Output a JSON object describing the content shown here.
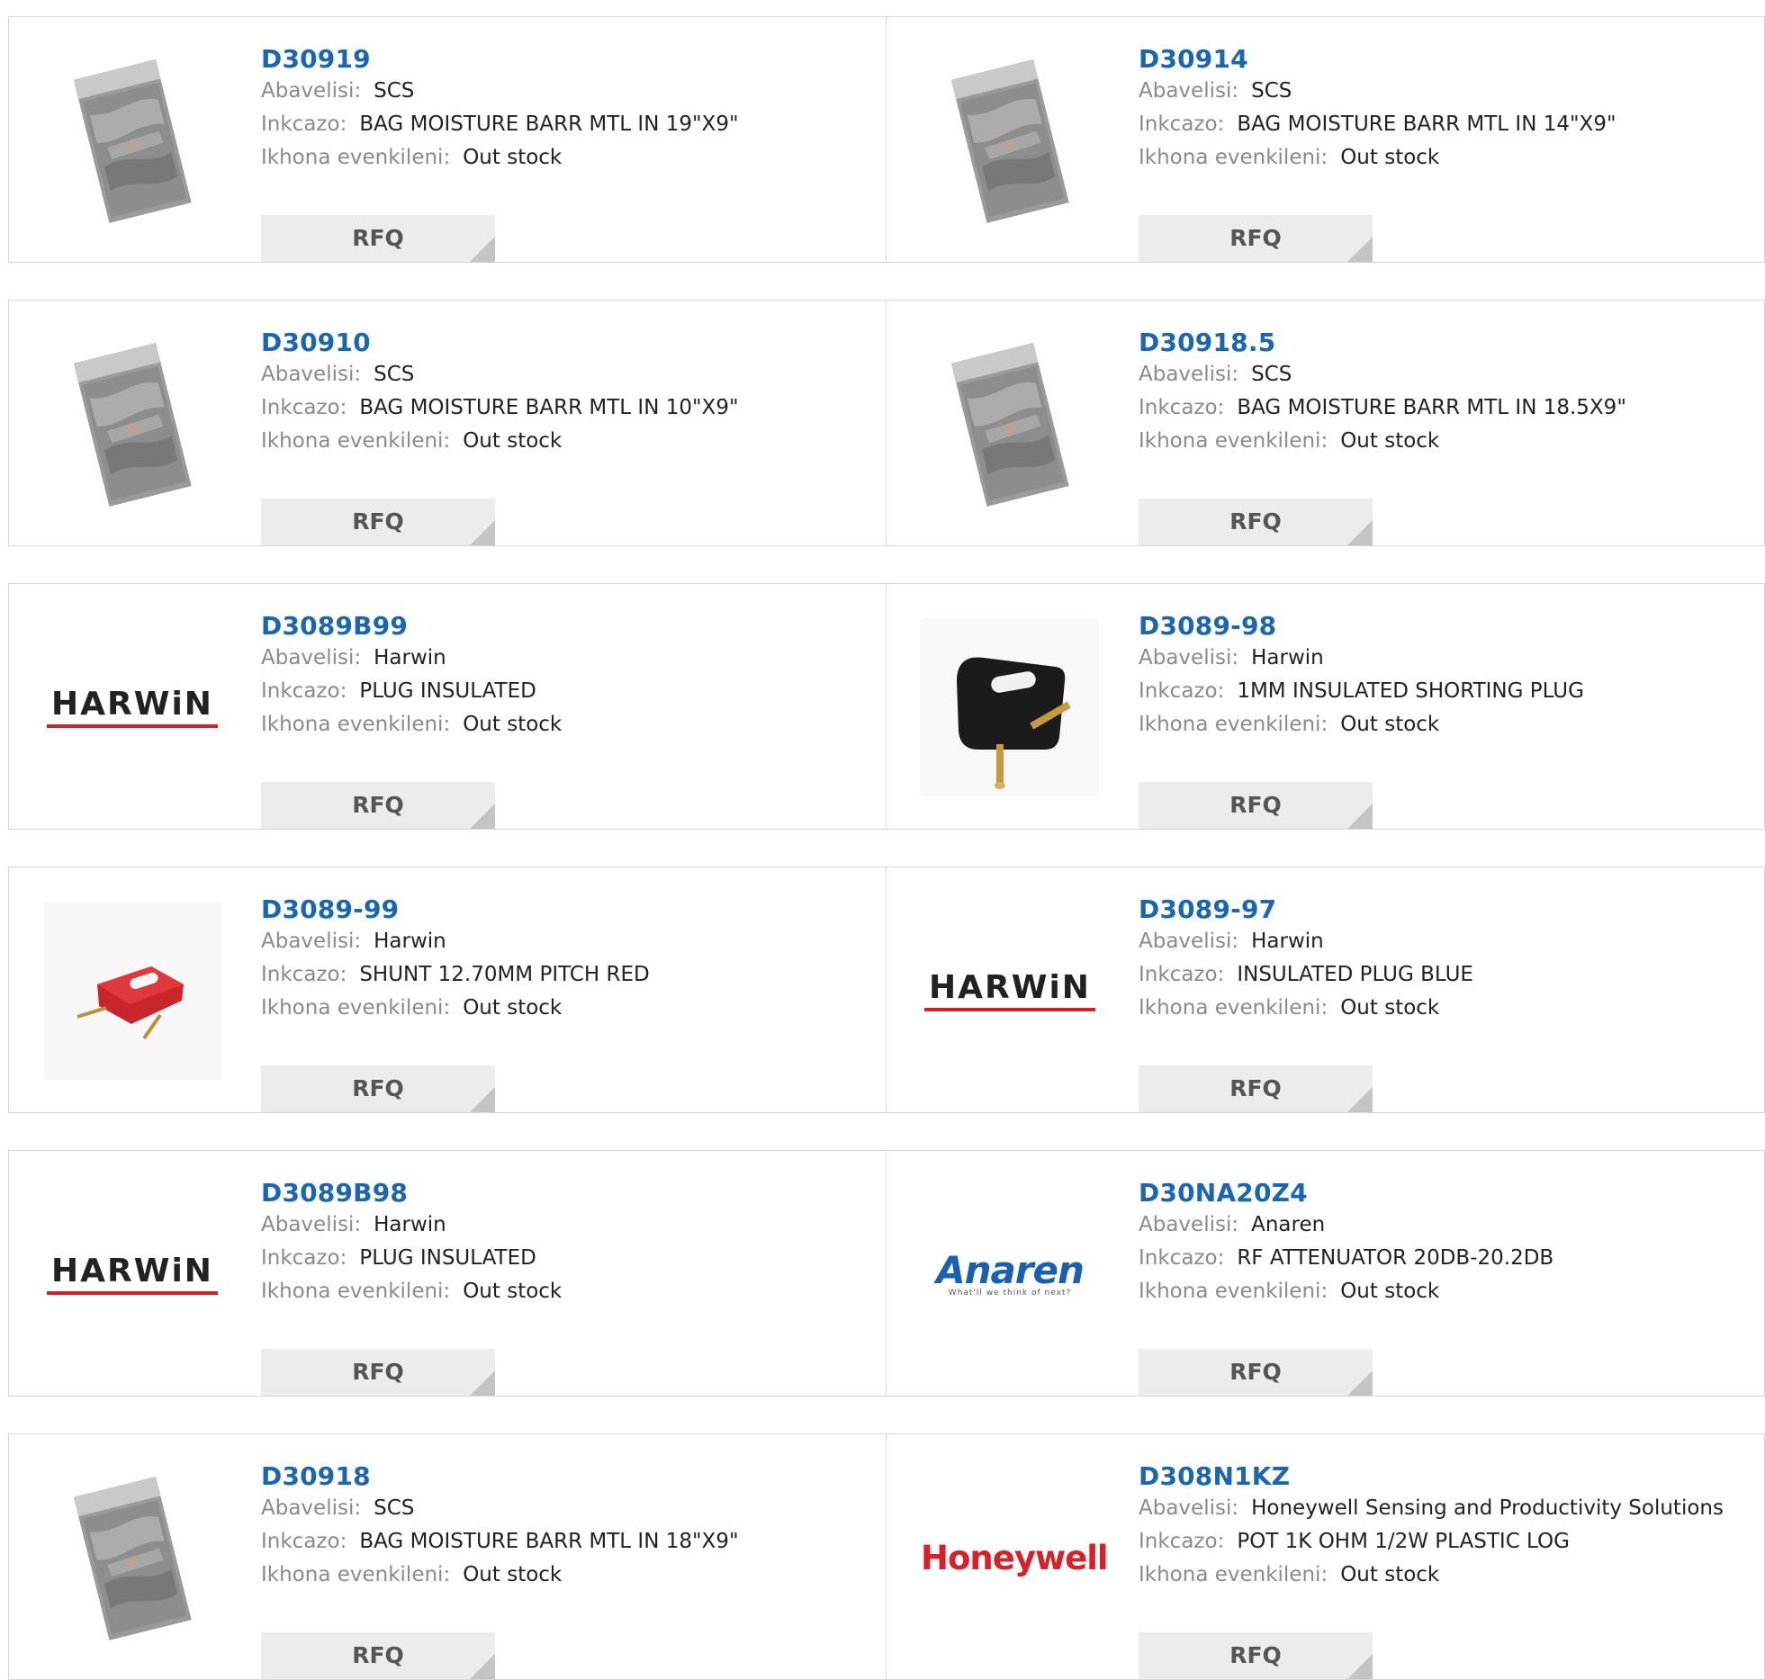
{
  "labels": {
    "manufacturer": "Abavelisi:",
    "description": "Inkcazo:",
    "stock": "Ikhona evenkileni:",
    "rfq": "RFQ"
  },
  "rows": [
    [
      {
        "part": "D30919",
        "manufacturer": "SCS",
        "description": "BAG MOISTURE BARR MTL IN 19\"X9\"",
        "stock": "Out stock",
        "image": "moisture-bag"
      },
      {
        "part": "D30914",
        "manufacturer": "SCS",
        "description": "BAG MOISTURE BARR MTL IN 14\"X9\"",
        "stock": "Out stock",
        "image": "moisture-bag"
      }
    ],
    [
      {
        "part": "D30910",
        "manufacturer": "SCS",
        "description": "BAG MOISTURE BARR MTL IN 10\"X9\"",
        "stock": "Out stock",
        "image": "moisture-bag"
      },
      {
        "part": "D30918.5",
        "manufacturer": "SCS",
        "description": "BAG MOISTURE BARR MTL IN 18.5X9\"",
        "stock": "Out stock",
        "image": "moisture-bag"
      }
    ],
    [
      {
        "part": "D3089B99",
        "manufacturer": "Harwin",
        "description": "PLUG INSULATED",
        "stock": "Out stock",
        "image": "harwin-logo"
      },
      {
        "part": "D3089-98",
        "manufacturer": "Harwin",
        "description": "1MM INSULATED SHORTING PLUG",
        "stock": "Out stock",
        "image": "black-shorting-plug"
      }
    ],
    [
      {
        "part": "D3089-99",
        "manufacturer": "Harwin",
        "description": "SHUNT 12.70MM PITCH RED",
        "stock": "Out stock",
        "image": "red-shunt"
      },
      {
        "part": "D3089-97",
        "manufacturer": "Harwin",
        "description": "INSULATED PLUG BLUE",
        "stock": "Out stock",
        "image": "harwin-logo"
      }
    ],
    [
      {
        "part": "D3089B98",
        "manufacturer": "Harwin",
        "description": "PLUG INSULATED",
        "stock": "Out stock",
        "image": "harwin-logo"
      },
      {
        "part": "D30NA20Z4",
        "manufacturer": "Anaren",
        "description": "RF ATTENUATOR 20DB-20.2DB",
        "stock": "Out stock",
        "image": "anaren-logo"
      }
    ],
    [
      {
        "part": "D30918",
        "manufacturer": "SCS",
        "description": "BAG MOISTURE BARR MTL IN 18\"X9\"",
        "stock": "Out stock",
        "image": "moisture-bag"
      },
      {
        "part": "D308N1KZ",
        "manufacturer": "Honeywell Sensing and Productivity Solutions",
        "description": "POT 1K OHM 1/2W PLASTIC LOG",
        "stock": "Out stock",
        "image": "honeywell-logo"
      }
    ]
  ],
  "logos": {
    "harwin": "HARWiN",
    "anaren": "Anaren",
    "anaren_tagline": "What'll we think of next?",
    "honeywell": "Honeywell"
  },
  "colors": {
    "part_link": "#1a66b0",
    "harwin_red": "#d0202a",
    "anaren_blue": "#1a5fb0",
    "honeywell_red": "#d8202a"
  }
}
